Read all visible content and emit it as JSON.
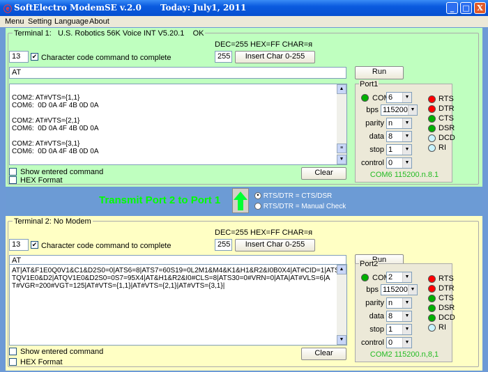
{
  "window": {
    "app": "SoftElectro",
    "title": "ModemSE v.2.0",
    "date": "Today: July1, 2011",
    "minimize": "_",
    "maximize": "□",
    "close": "X"
  },
  "menu": [
    "Menu",
    "Setting",
    "Language",
    "About"
  ],
  "terminals": [
    {
      "label": "Terminal 1:   U.S. Robotics 56K Voice INT V5.20.1    OK",
      "dec_info": "DEC=255 HEX=FF CHAR=я",
      "char_code": "13",
      "char_code_checked": true,
      "char_code_label": "Character code command to complete",
      "insert_value": "255",
      "insert_label": "Insert Char 0-255",
      "command": "AT",
      "run_label": "Run",
      "output": "\nCOM2: AT#VTS={1,1}\nCOM6:  0D 0A 4F 4B 0D 0A\n\nCOM2: AT#VTS={2,1}\nCOM6:  0D 0A 4F 4B 0D 0A\n\nCOM2: AT#VTS={3,1}\nCOM6:  0D 0A 4F 4B 0D 0A",
      "show_cmd_label": "Show entered command",
      "hex_label": "HEX Format",
      "clear_label": "Clear",
      "port": {
        "title": "Port1",
        "com_label": "COM",
        "com": "6",
        "bps_label": "bps",
        "bps": "115200",
        "parity_label": "parity",
        "parity": "n",
        "data_label": "data",
        "data": "8",
        "stop_label": "stop",
        "stop": "1",
        "control_label": "control",
        "control": "0",
        "status": "COM6 115200.n.8.1",
        "signals": [
          {
            "name": "RTS",
            "color": "#ff0000"
          },
          {
            "name": "DTR",
            "color": "#ff0000"
          },
          {
            "name": "CTS",
            "color": "#00b000"
          },
          {
            "name": "DSR",
            "color": "#00b000"
          },
          {
            "name": "DCD",
            "color": "#c8f4ff"
          },
          {
            "name": "RI",
            "color": "#c8f4ff"
          }
        ],
        "com_led": "#00b000"
      }
    },
    {
      "label": "Terminal 2: No Modem",
      "dec_info": "DEC=255 HEX=FF CHAR=я",
      "char_code": "13",
      "char_code_checked": true,
      "char_code_label": "Character code command to complete",
      "insert_value": "255",
      "insert_label": "Insert Char 0-255",
      "command": "AT",
      "run_label": "Run",
      "output": "AT|AT&F1E0Q0V1&C1&D2S0=0|ATS6=8|ATS7=60S19=0L2M1&M4&K1&H1&R2&I0B0X4|AT#CID=1|ATS0=0|ATH0|A\nTQV1E0&D2|ATQV1E0&D2S0=0S7=95X4|AT&H1&R2&I0#CLS=8|ATS30=0#VRN=0|ATA|AT#VLS=6|A\nT#VGR=200#VGT=125|AT#VTS={1,1}|AT#VTS={2,1}|AT#VTS={3,1}|",
      "show_cmd_label": "Show entered command",
      "hex_label": "HEX Format",
      "clear_label": "Clear",
      "port": {
        "title": "Port2",
        "com_label": "COM",
        "com": "2",
        "bps_label": "bps",
        "bps": "115200",
        "parity_label": "parity",
        "parity": "n",
        "data_label": "data",
        "data": "8",
        "stop_label": "stop",
        "stop": "1",
        "control_label": "control",
        "control": "0",
        "status": "COM2 115200.n,8,1",
        "signals": [
          {
            "name": "RTS",
            "color": "#ff0000"
          },
          {
            "name": "DTR",
            "color": "#ff0000"
          },
          {
            "name": "CTS",
            "color": "#00b000"
          },
          {
            "name": "DSR",
            "color": "#00b000"
          },
          {
            "name": "DCD",
            "color": "#00b000"
          },
          {
            "name": "RI",
            "color": "#c8f4ff"
          }
        ],
        "com_led": "#00b000"
      }
    }
  ],
  "transmit": {
    "label": "Transmit Port 2 to Port 1",
    "arrow": "up-arrow-icon",
    "options": [
      {
        "label": "RTS/DTR = CTS/DSR",
        "selected": true
      },
      {
        "label": "RTS/DTR = Manual Check",
        "selected": false
      }
    ]
  },
  "colors": {
    "terminal1_bg": "#bfffbf",
    "terminal2_bg": "#ffffc4",
    "accent_green": "#00ff00",
    "status_green": "#22bb22"
  }
}
